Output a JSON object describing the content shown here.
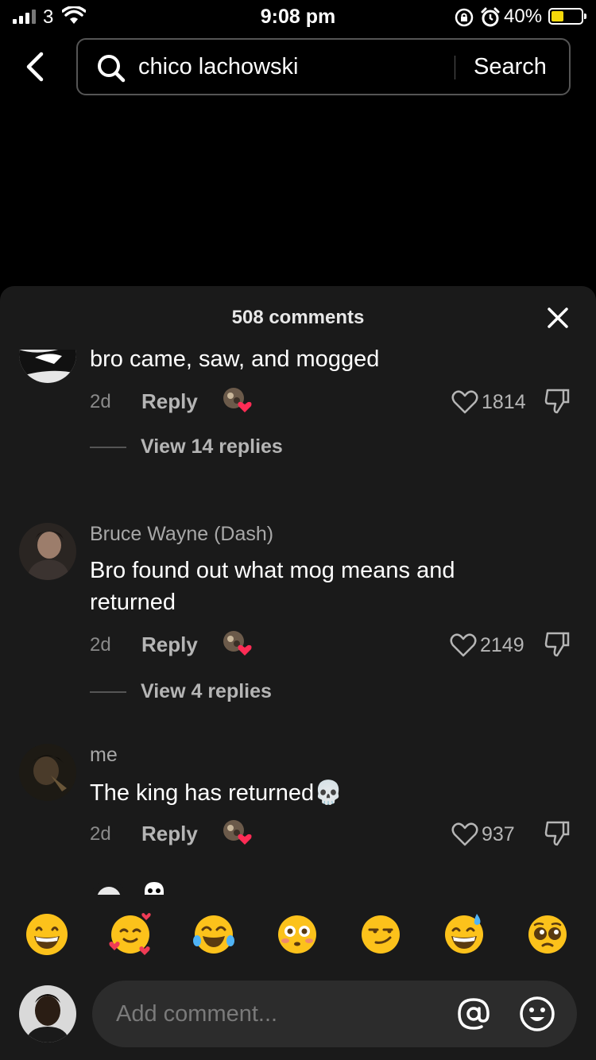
{
  "status_bar": {
    "carrier": "3",
    "time": "9:08 pm",
    "battery_percent": "40%",
    "battery_level": 0.4
  },
  "search": {
    "query": "chico lachowski",
    "button_label": "Search"
  },
  "comments_panel": {
    "title": "508 comments",
    "comments": [
      {
        "username": ".",
        "text": "bro came, saw, and mogged",
        "age": "2d",
        "reply_label": "Reply",
        "likes": "1814",
        "view_replies": "View 14 replies"
      },
      {
        "username": "Bruce Wayne (Dash)",
        "text": "Bro found out what mog means and returned",
        "age": "2d",
        "reply_label": "Reply",
        "likes": "2149",
        "view_replies": "View 4 replies"
      },
      {
        "username": "me",
        "text": "The king has returned💀",
        "age": "2d",
        "reply_label": "Reply",
        "likes": "937"
      }
    ],
    "emoji_bar": [
      "😁",
      "🥰",
      "😂",
      "😳",
      "😏",
      "😅",
      "🥺"
    ],
    "input": {
      "placeholder": "Add comment..."
    }
  },
  "colors": {
    "sheet_bg": "#1a1a1a",
    "like_heart": "#fe2c55",
    "battery": "#f5d90a"
  }
}
